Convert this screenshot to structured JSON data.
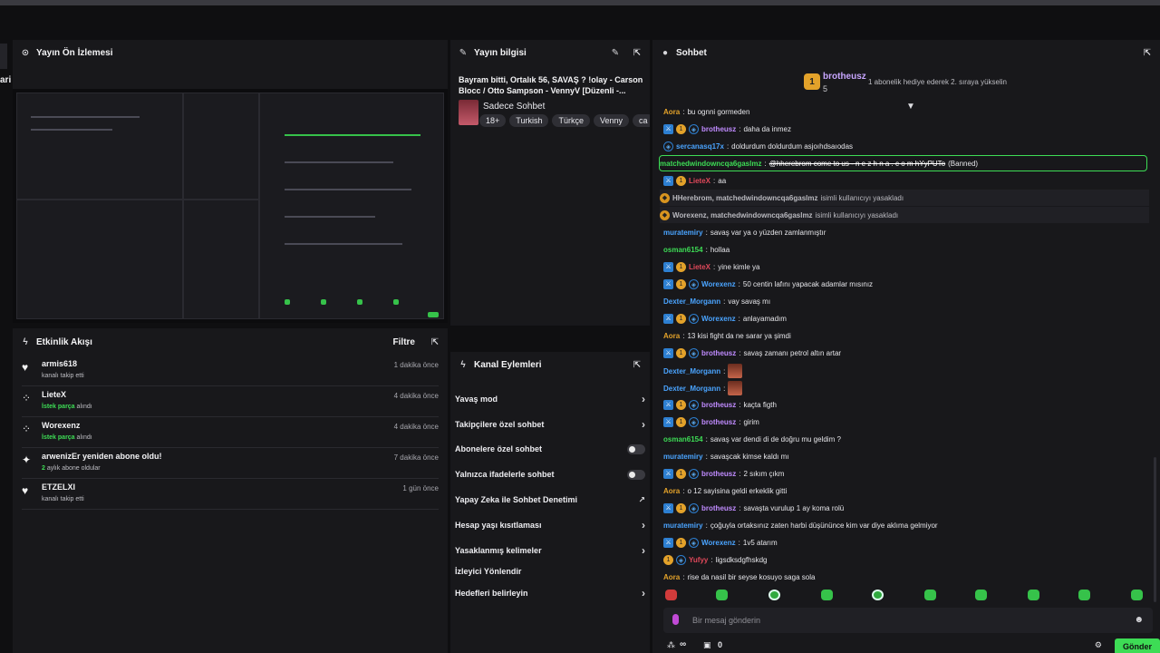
{
  "left_edge": {
    "label": "ari"
  },
  "preview": {
    "title": "Yayın Ön İzlemesi"
  },
  "activity": {
    "title": "Etkinlik Akışı",
    "filter_label": "Filtre",
    "items": [
      {
        "name": "armis618",
        "highlight": "",
        "sub": "kanalı takip etti",
        "time": "1 dakika önce",
        "icon": "heart-icon"
      },
      {
        "name": "LieteX",
        "highlight": "İstek parça",
        "sub": "alındı",
        "time": "4 dakika önce",
        "icon": "dots-icon"
      },
      {
        "name": "Worexenz",
        "highlight": "İstek parça",
        "sub": "alındı",
        "time": "4 dakika önce",
        "icon": "dots-icon"
      },
      {
        "name": "arwenizEr yeniden abone oldu!",
        "highlight": "2",
        "sub": "aylık abone oldular",
        "time": "7 dakika önce",
        "icon": "star-icon"
      },
      {
        "name": "ETZELXI",
        "highlight": "",
        "sub": "kanalı takip etti",
        "time": "1 gün önce",
        "icon": "heart-icon"
      }
    ]
  },
  "stream_info": {
    "title_label": "Yayın bilgisi",
    "stream_title": "Bayram bitti, Ortalık 56, SAVAŞ ? !olay - Carson Blocc / Otto Sampson - VennyV [Düzenli -...",
    "category": "Sadece Sohbet",
    "tags": [
      "18+",
      "Turkish",
      "Türkçe",
      "Venny",
      "ca"
    ]
  },
  "channel_actions": {
    "title": "Kanal Eylemleri",
    "rows": [
      {
        "label": "Yavaş mod",
        "control": "chevron"
      },
      {
        "label": "Takipçilere özel sohbet",
        "control": "chevron"
      },
      {
        "label": "Abonelere özel sohbet",
        "control": "toggle"
      },
      {
        "label": "Yalnızca ifadelerle sohbet",
        "control": "toggle"
      },
      {
        "label": "Yapay Zeka ile Sohbet Denetimi",
        "control": "external"
      },
      {
        "label": "Hesap yaşı kısıtlaması",
        "control": "chevron"
      },
      {
        "label": "Yasaklanmış kelimeler",
        "control": "chevron"
      },
      {
        "label": "İzleyici Yönlendir",
        "control": "none"
      },
      {
        "label": "Hedefleri belirleyin",
        "control": "chevron"
      }
    ]
  },
  "chat": {
    "title": "Sohbet",
    "pinned": {
      "user": "brotheusz",
      "count": "5",
      "badge": "1",
      "text": "1 abonelik hediye ederek 2. sıraya yükselin"
    },
    "messages": [
      {
        "user": "Aora",
        "color": "#e3a22a",
        "badges": [],
        "text": "bu ognni gormeden",
        "kind": "normal"
      },
      {
        "user": "brotheusz",
        "color": "#c08bff",
        "badges": [
          "mod",
          "sub",
          "gift"
        ],
        "text": "daha da inmez",
        "kind": "normal"
      },
      {
        "user": "sercanasq17x",
        "color": "#4aa4ff",
        "badges": [
          "gift"
        ],
        "text": "doldurdum doldurdum asjoıhdsaıodas",
        "kind": "normal"
      },
      {
        "user": "matchedwindowncqa6gaslmz",
        "color": "#3ddc55",
        "badges": [],
        "text": "@hherebrom come to us - n e z h n a . c o m hYyPUTo",
        "extra": "(Banned)",
        "kind": "highlight"
      },
      {
        "user": "LieteX",
        "color": "#e0485a",
        "badges": [
          "mod",
          "sub"
        ],
        "text": "aa",
        "kind": "normal"
      },
      {
        "user": "HHerebrom, matchedwindowncqa6gaslmz",
        "color": "#b9b9bf",
        "badges": [
          "shield"
        ],
        "text": "isimli kullanıcıyı yasakladı",
        "kind": "system"
      },
      {
        "user": "Worexenz, matchedwindowncqa6gaslmz",
        "color": "#b9b9bf",
        "badges": [
          "shield"
        ],
        "text": "isimli kullanıcıyı yasakladı",
        "kind": "system"
      },
      {
        "user": "muratemiry",
        "color": "#4aa4ff",
        "badges": [],
        "text": "savaş var ya o yüzden zamlanmıştır",
        "kind": "normal"
      },
      {
        "user": "osman6154",
        "color": "#3ddc55",
        "badges": [],
        "text": "hollaa",
        "kind": "normal"
      },
      {
        "user": "LieteX",
        "color": "#e0485a",
        "badges": [
          "mod",
          "sub"
        ],
        "text": "yine kimle ya",
        "kind": "normal"
      },
      {
        "user": "Worexenz",
        "color": "#4aa4ff",
        "badges": [
          "mod",
          "sub",
          "gift"
        ],
        "text": "50 centin lafını yapacak adamlar mısınız",
        "kind": "normal"
      },
      {
        "user": "Dexter_Morgann",
        "color": "#4aa4ff",
        "badges": [],
        "text": "vay savaş mı",
        "kind": "normal"
      },
      {
        "user": "Worexenz",
        "color": "#4aa4ff",
        "badges": [
          "mod",
          "sub",
          "gift"
        ],
        "text": "anlayamadım",
        "kind": "normal"
      },
      {
        "user": "Aora",
        "color": "#e3a22a",
        "badges": [],
        "text": "13 kisi fight da ne sarar ya şimdi",
        "kind": "normal"
      },
      {
        "user": "brotheusz",
        "color": "#c08bff",
        "badges": [
          "mod",
          "sub",
          "gift"
        ],
        "text": "savaş zamanı petrol altın artar",
        "kind": "normal"
      },
      {
        "user": "Dexter_Morgann",
        "color": "#4aa4ff",
        "badges": [],
        "text": "",
        "kind": "emote"
      },
      {
        "user": "Dexter_Morgann",
        "color": "#4aa4ff",
        "badges": [],
        "text": "",
        "kind": "emote"
      },
      {
        "user": "brotheusz",
        "color": "#c08bff",
        "badges": [
          "mod",
          "sub",
          "gift"
        ],
        "text": "kaçta figth",
        "kind": "normal"
      },
      {
        "user": "brotheusz",
        "color": "#c08bff",
        "badges": [
          "mod",
          "sub",
          "gift"
        ],
        "text": "girim",
        "kind": "normal"
      },
      {
        "user": "osman6154",
        "color": "#3ddc55",
        "badges": [],
        "text": "savaş var dendi di de doğru mu geldim ?",
        "kind": "normal"
      },
      {
        "user": "muratemiry",
        "color": "#4aa4ff",
        "badges": [],
        "text": "savaşcak kimse kaldı mı",
        "kind": "normal"
      },
      {
        "user": "brotheusz",
        "color": "#c08bff",
        "badges": [
          "mod",
          "sub",
          "gift"
        ],
        "text": "2 sıkım çıkm",
        "kind": "normal"
      },
      {
        "user": "Aora",
        "color": "#e3a22a",
        "badges": [],
        "text": "o 12 sayisina geldi erkeklik gitti",
        "kind": "normal"
      },
      {
        "user": "brotheusz",
        "color": "#c08bff",
        "badges": [
          "mod",
          "sub",
          "gift"
        ],
        "text": "savaşta vurulup 1 ay koma rolü",
        "kind": "normal"
      },
      {
        "user": "muratemiry",
        "color": "#4aa4ff",
        "badges": [],
        "text": "çoğuyla ortaksınız zaten harbi düşününce kim var diye aklıma gelmiyor",
        "kind": "normal"
      },
      {
        "user": "Worexenz",
        "color": "#4aa4ff",
        "badges": [
          "mod",
          "sub",
          "gift"
        ],
        "text": "1v5 atarım",
        "kind": "normal"
      },
      {
        "user": "Yufyy",
        "color": "#e0485a",
        "badges": [
          "sub",
          "gift"
        ],
        "text": "ligsdksdgfhskdg",
        "kind": "normal"
      },
      {
        "user": "Aora",
        "color": "#e3a22a",
        "badges": [],
        "text": "rise da nasil bir seyse kosuyo saga sola",
        "kind": "normal"
      }
    ],
    "input_placeholder": "Bir mesaj gönderin",
    "footer": {
      "viewers": "∞",
      "points": "0",
      "send_label": "Gönder"
    }
  }
}
